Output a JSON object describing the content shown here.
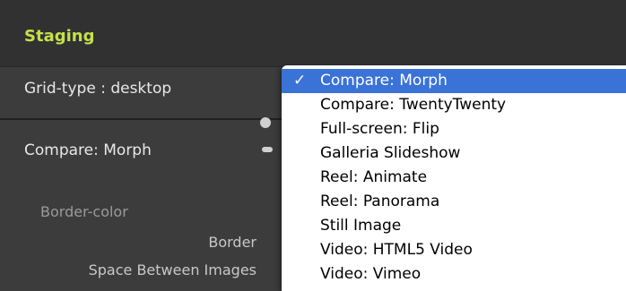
{
  "header": {
    "title": "Staging"
  },
  "grid_type": {
    "label": "Grid-type : desktop"
  },
  "section": {
    "label": "Compare: Morph",
    "border_color_label": "Border-color",
    "border_label": "Border",
    "space_label": "Space Between Images"
  },
  "menu": {
    "check_glyph": "✓",
    "selected_index": 0,
    "items": [
      {
        "label": "Compare: Morph"
      },
      {
        "label": "Compare: TwentyTwenty"
      },
      {
        "label": "Full-screen: Flip"
      },
      {
        "label": "Galleria Slideshow"
      },
      {
        "label": "Reel: Animate"
      },
      {
        "label": "Reel: Panorama"
      },
      {
        "label": "Still Image"
      },
      {
        "label": "Video: HTML5 Video"
      },
      {
        "label": "Video: Vimeo"
      }
    ]
  },
  "colors": {
    "accent_title": "#c4e04a",
    "selection": "#3a72d8"
  }
}
